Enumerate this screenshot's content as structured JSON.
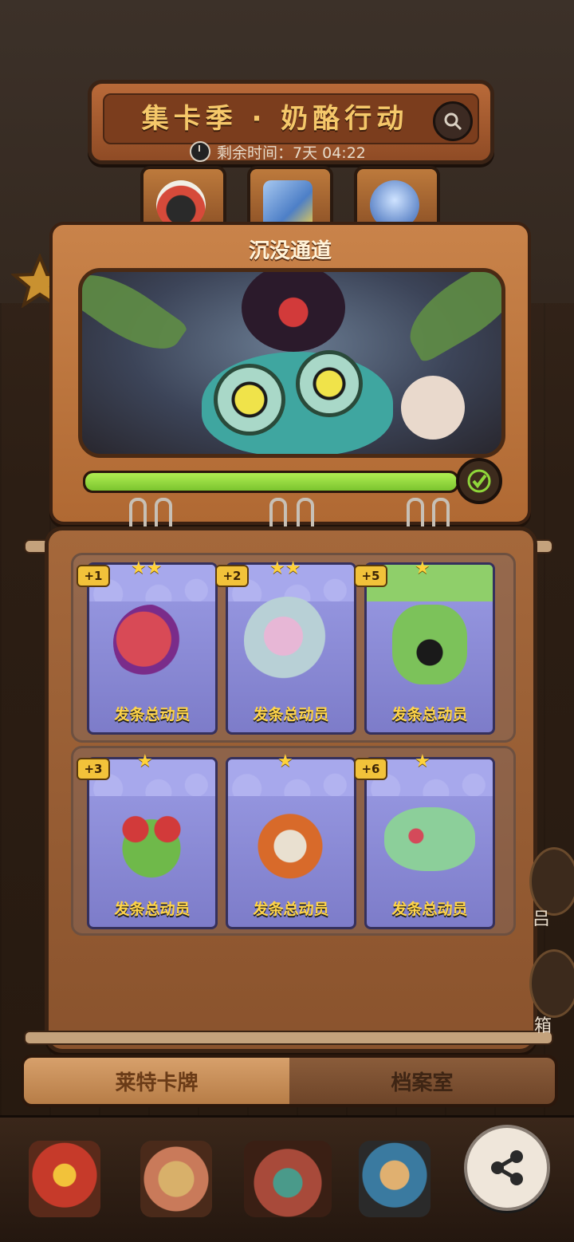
{
  "header": {
    "title": "集卡季 · 奶酪行动",
    "timer_label": "剩余时间：7天 04:22"
  },
  "chapter": {
    "title": "沉没通道",
    "progress_fraction": 1.0,
    "completed": true
  },
  "cards": [
    {
      "name": "发条总动员",
      "badge": "+1",
      "stars": "★★"
    },
    {
      "name": "发条总动员",
      "badge": "+2",
      "stars": "★★"
    },
    {
      "name": "发条总动员",
      "badge": "+5",
      "stars": "★"
    },
    {
      "name": "发条总动员",
      "badge": "+3",
      "stars": "★"
    },
    {
      "name": "发条总动员",
      "badge": "",
      "stars": "★"
    },
    {
      "name": "发条总动员",
      "badge": "+6",
      "stars": "★"
    }
  ],
  "tabs": {
    "tab1": "莱特卡牌",
    "tab2": "档案室"
  },
  "side_texts": {
    "a": "吕",
    "b": "箱"
  },
  "icons": {
    "search": "search-icon",
    "clock": "clock-icon",
    "check": "check-icon",
    "share": "share-icon"
  },
  "colors": {
    "accent_gold": "#f5c86a",
    "progress_green": "#8fd63a",
    "card_purple": "#8c8cd8"
  }
}
